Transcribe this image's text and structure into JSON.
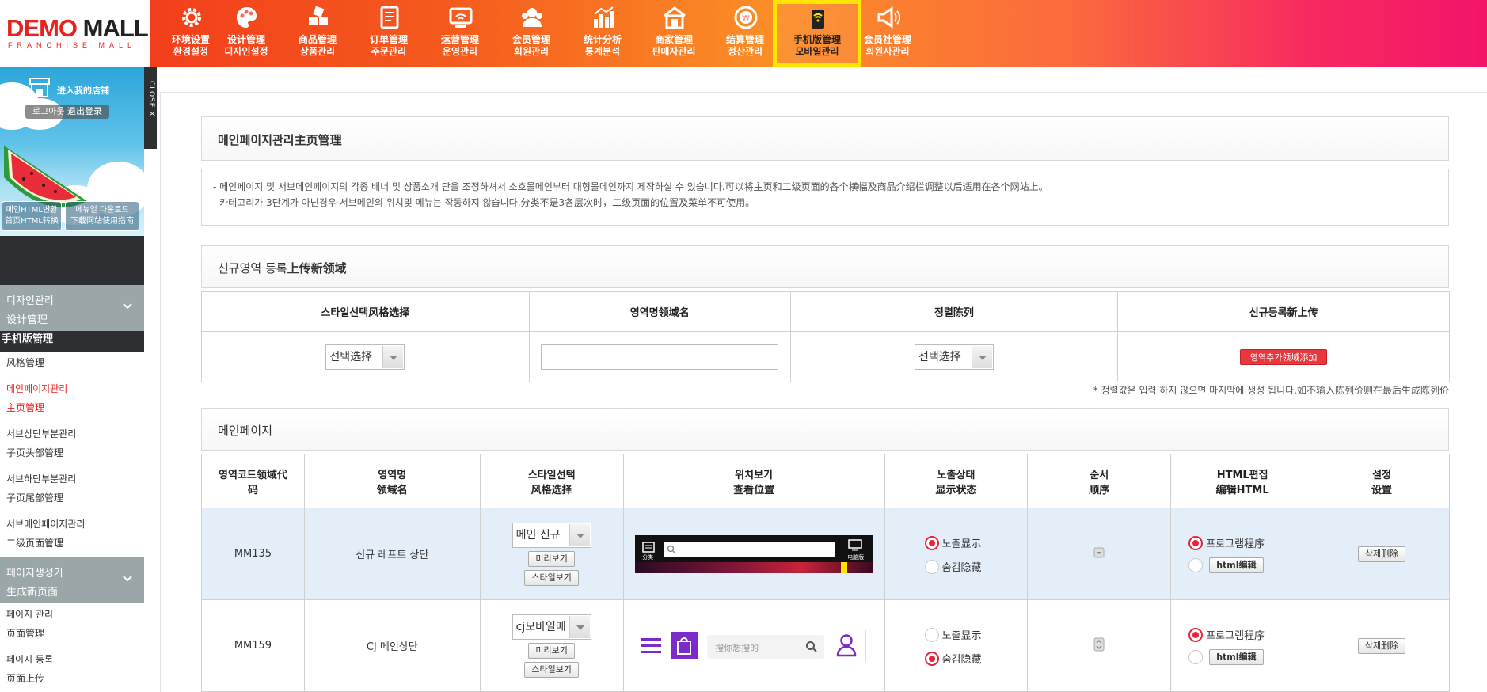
{
  "header": {
    "logo_main_a": "DEMO",
    "logo_main_b": "MALL",
    "logo_sub": "FRANCHISE MALL",
    "nav": [
      {
        "line1": "环境设置",
        "line2": "환경설정",
        "icon": "gear-icon"
      },
      {
        "line1": "设计管理",
        "line2": "디자인설정",
        "icon": "palette-icon"
      },
      {
        "line1": "商品管理",
        "line2": "상품관리",
        "icon": "products-icon"
      },
      {
        "line1": "订单管理",
        "line2": "주문관리",
        "icon": "order-icon"
      },
      {
        "line1": "运营管理",
        "line2": "운영관리",
        "icon": "monitor-wifi-icon"
      },
      {
        "line1": "会员管理",
        "line2": "회원관리",
        "icon": "members-icon"
      },
      {
        "line1": "统计分析",
        "line2": "통계분석",
        "icon": "bar-chart-icon"
      },
      {
        "line1": "商家管理",
        "line2": "판매자관리",
        "icon": "store-icon"
      },
      {
        "line1": "结算管理",
        "line2": "정산관리",
        "icon": "won-coin-icon"
      },
      {
        "line1": "手机版管理",
        "line2": "모바일관리",
        "icon": "mobile-wifi-icon",
        "active": true
      },
      {
        "line1": "会员社管理",
        "line2": "회원사관리",
        "icon": "megaphone-icon"
      }
    ]
  },
  "sidebar": {
    "shop_link": "进入我的店铺",
    "logout": "로그아웃 退出登录",
    "close_tab": "CLOSE X",
    "btn_html_a": "메인HTML변환",
    "btn_html_b": "首页HTML转换",
    "btn_manual_a": "메뉴얼 다운로드",
    "btn_manual_b": "下载网站使用指南",
    "section_title": "手机版管理",
    "groups": [
      {
        "a": "디자인관리",
        "b": "设计管理"
      },
      {
        "a": "페이지생성기",
        "b": "生成新页面"
      }
    ],
    "items_design": [
      {
        "a": "스타일관리",
        "b": "风格管理"
      },
      {
        "a": "메인페이지관리",
        "b": "主页管理",
        "active": true
      },
      {
        "a": "서브상단부분관리",
        "b": "子页头部管理"
      },
      {
        "a": "서브하단부분관리",
        "b": "子页尾部管理"
      },
      {
        "a": "서브메인페이지관리",
        "b": "二级页面管理"
      }
    ],
    "items_page": [
      {
        "a": "페이지 관리",
        "b": "页面管理"
      },
      {
        "a": "페이지 등록",
        "b": "页面上传"
      }
    ]
  },
  "page": {
    "title_ko": "메인페이지관리",
    "title_cn": "主页管理",
    "notes": [
      "- 메인페이지 및 서브메인페이지의 각종 배너 및 상품소개 단을 조정하셔서 소호몰메인부터 대형몰메인까지 제작하실 수 있습니다.可以将主页和二级页面的各个横幅及商品介绍栏调整以后适用在各个网站上。",
      "- 카테고리가 3단계가 아닌경우 서브메인의 위치및 메뉴는 작동하지 않습니다.分类不是3各层次时，二级页面的位置及菜单不可使用。"
    ]
  },
  "new_area": {
    "title_ko": "신규영역 등록",
    "title_cn": "上传新领域",
    "headers": [
      "스타일선택风格选择",
      "영역명领域名",
      "정렬陈列",
      "신규등록新上传"
    ],
    "style_select": "선택选择",
    "sort_select": "선택选择",
    "name_value": "",
    "add_button": "영역추가领域添加",
    "footnote": "* 정렬값은 입력 하지 않으면 마지막에 생성 됩니다.如不输入陈列价则在最后生成陈列价"
  },
  "main_list": {
    "title": "메인페이지",
    "headers": [
      {
        "a": "영역코드领域代",
        "b": "码"
      },
      {
        "a": "영역명",
        "b": "领域名"
      },
      {
        "a": "스타일선택",
        "b": "风格选择"
      },
      {
        "a": "위치보기",
        "b": "查看位置"
      },
      {
        "a": "노출상태",
        "b": "显示状态"
      },
      {
        "a": "순서",
        "b": "顺序"
      },
      {
        "a": "HTML편집",
        "b": "编辑HTML"
      },
      {
        "a": "설정",
        "b": "设置"
      }
    ],
    "rows": [
      {
        "code": "MM135",
        "name": "신규 레프트 상단",
        "style": "메인 신규",
        "preview_btn": "미리보기",
        "style_view_btn": "스타일보기",
        "preview_search_placeholder": "",
        "preview_left_label": "分类",
        "preview_right_label": "电脑版",
        "status_show": "노출显示",
        "status_hide": "숨김隐藏",
        "status": "show",
        "html_program": "프로그램程序",
        "html_edit": "html编辑",
        "html_mode": "program",
        "delete_btn": "삭제删除"
      },
      {
        "code": "MM159",
        "name": "CJ 메인상단",
        "style": "cj모바일메",
        "preview_btn": "미리보기",
        "style_view_btn": "스타일보기",
        "preview_search_placeholder": "搜你想搜的",
        "status_show": "노출显示",
        "status_hide": "숨김隐藏",
        "status": "hide",
        "html_program": "프로그램程序",
        "html_edit": "html编辑",
        "html_mode": "program",
        "delete_btn": "삭제删除"
      }
    ]
  },
  "colors": {
    "accent_red": "#e8383d",
    "highlight_yellow": "#ffe600",
    "row_highlight": "#e4eef9",
    "purple": "#7c2bc8"
  }
}
